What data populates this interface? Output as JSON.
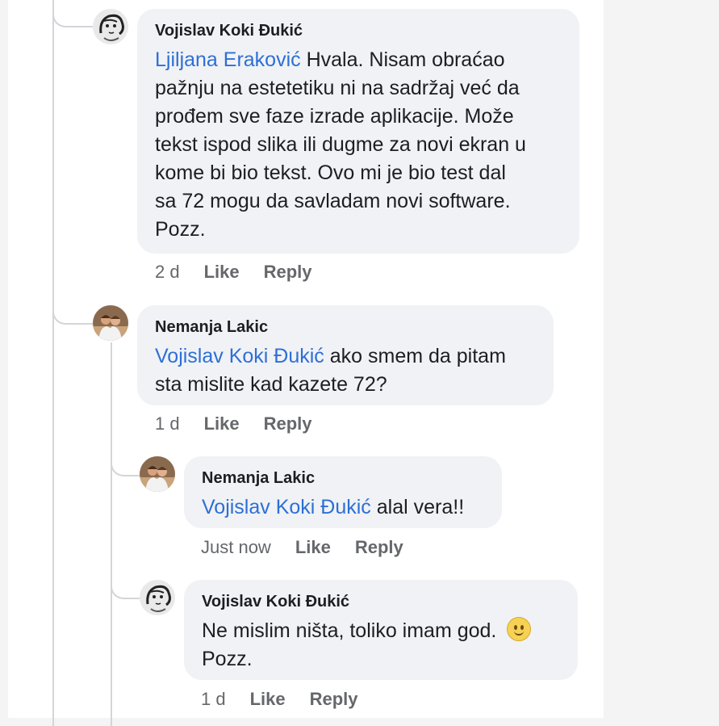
{
  "comments": [
    {
      "author": "Vojislav Koki Đukić",
      "mention": "Ljiljana Eraković",
      "lines": [
        " Hvala. Nisam obraćao",
        "pažnju na estetetiku ni na sadržaj već da",
        "prođem sve faze izrade aplikacije. Može",
        "tekst ispod slika ili dugme za novi ekran u",
        "kome bi bio tekst.  Ovo mi je bio test dal",
        "sa 72 mogu da savladam novi software.",
        "Pozz."
      ],
      "time": "2 d",
      "like": "Like",
      "reply": "Reply"
    },
    {
      "author": "Nemanja Lakic",
      "mention": "Vojislav Koki Đukić",
      "line1": " ako smem da pitam",
      "line2": "sta mislite kad kazete 72?",
      "time": "1 d",
      "like": "Like",
      "reply": "Reply"
    },
    {
      "author": "Nemanja Lakic",
      "mention": "Vojislav Koki Đukić",
      "line1": " alal vera!!",
      "time": "Just now",
      "like": "Like",
      "reply": "Reply"
    },
    {
      "author": "Vojislav Koki Đukić",
      "line1": "Ne mislim ništa, toliko imam god. ",
      "emoji": "slightly-smiling-face",
      "line2": "Pozz.",
      "time": "1 d",
      "like": "Like",
      "reply": "Reply"
    }
  ]
}
